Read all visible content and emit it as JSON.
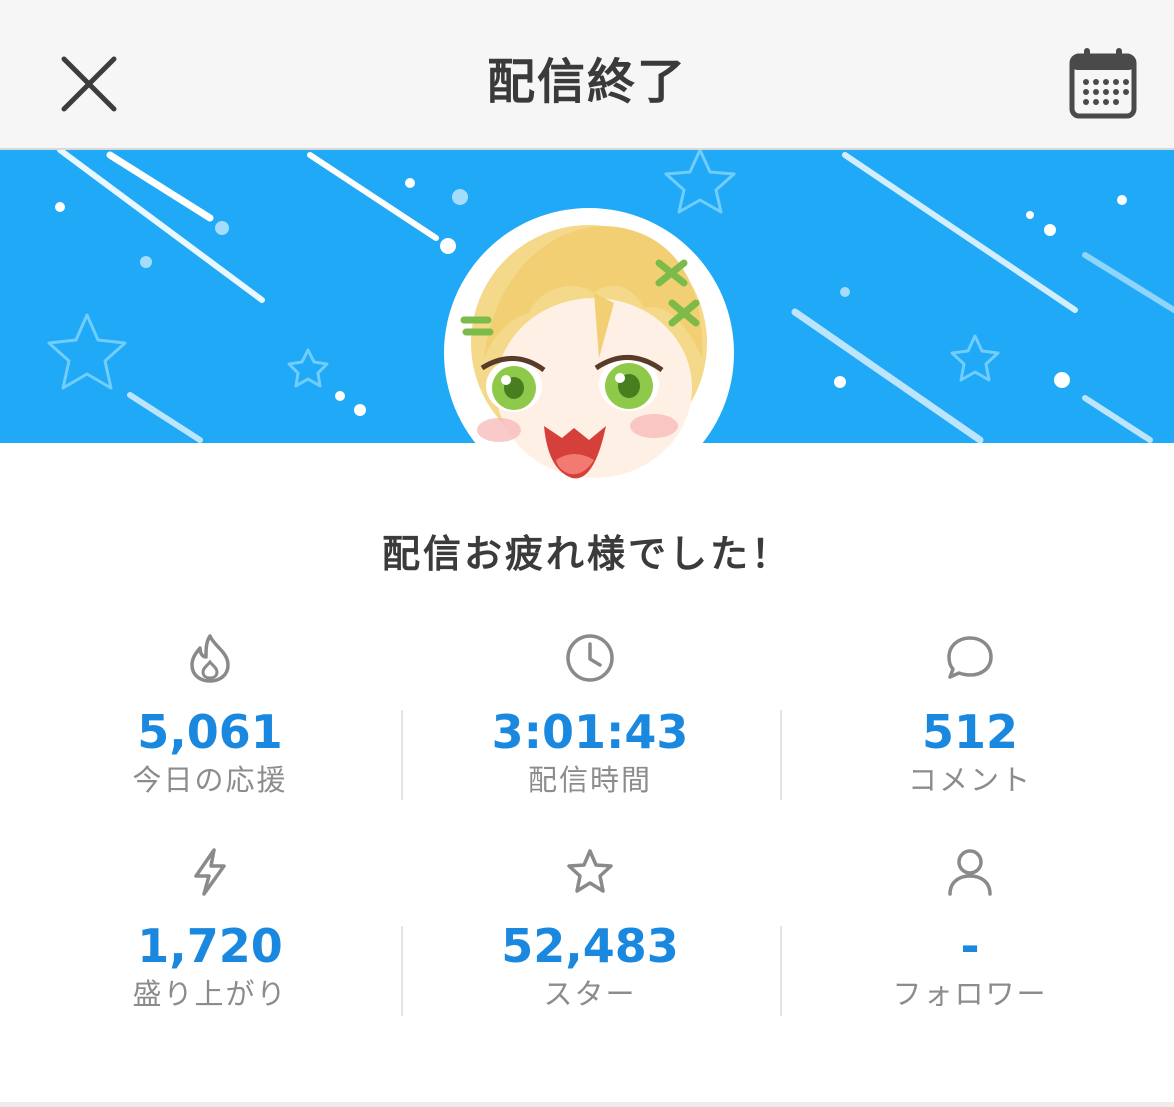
{
  "header": {
    "title": "配信終了",
    "close_icon": "close-icon",
    "calendar_icon": "calendar-icon"
  },
  "banner": {
    "background_color": "#1fa9f6"
  },
  "message": "配信お疲れ様でした！",
  "stats": [
    {
      "icon": "fire-icon",
      "value": "5,061",
      "label": "今日の応援"
    },
    {
      "icon": "clock-icon",
      "value": "3:01:43",
      "label": "配信時間"
    },
    {
      "icon": "comment-icon",
      "value": "512",
      "label": "コメント"
    },
    {
      "icon": "lightning-icon",
      "value": "1,720",
      "label": "盛り上がり"
    },
    {
      "icon": "star-icon",
      "value": "52,483",
      "label": "スター"
    },
    {
      "icon": "person-icon",
      "value": "-",
      "label": "フォロワー"
    }
  ],
  "colors": {
    "value_blue": "#1a88de",
    "label_gray": "#8c8c8c",
    "icon_gray": "#8a8a8a"
  }
}
